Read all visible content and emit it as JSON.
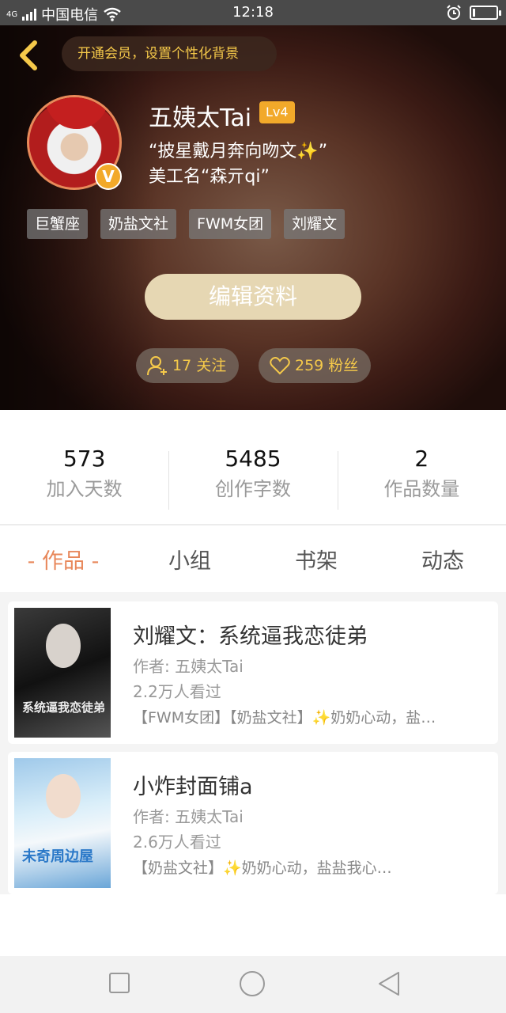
{
  "status_bar": {
    "network": "4G",
    "carrier": "中国电信",
    "time": "12:18"
  },
  "header": {
    "vip_banner": "开通会员，设置个性化背景",
    "username": "五姨太Tai",
    "level": "Lv4",
    "verified_badge": "V",
    "bio_line1": "“披星戴月奔向吻文✨”",
    "bio_line2": "美工名“森亓qi”",
    "tags": [
      "巨蟹座",
      "奶盐文社",
      "FWM女团",
      "刘耀文"
    ],
    "edit_button": "编辑资料",
    "following": "17 关注",
    "fans": "259 粉丝"
  },
  "stats": [
    {
      "value": "573",
      "label": "加入天数"
    },
    {
      "value": "5485",
      "label": "创作字数"
    },
    {
      "value": "2",
      "label": "作品数量"
    }
  ],
  "tabs": [
    "- 作品 -",
    "小组",
    "书架",
    "动态"
  ],
  "works": [
    {
      "title": "刘耀文：系统逼我恋徒弟",
      "author": "作者: 五姨太Tai",
      "views": "2.2万人看过",
      "desc": "【FWM女团】【奶盐文社】✨奶奶心动，盐…",
      "cover_text": "系统逼我恋徒弟"
    },
    {
      "title": "小炸封面铺a",
      "author": "作者: 五姨太Tai",
      "views": "2.6万人看过",
      "desc": "【奶盐文社】✨奶奶心动，盐盐我心…",
      "cover_text": "未奇周边屋"
    }
  ],
  "colors": {
    "accent": "#e8875a",
    "gold": "#f5c94a",
    "level_badge": "#f2a92a",
    "edit_button": "#e6d7b3"
  }
}
